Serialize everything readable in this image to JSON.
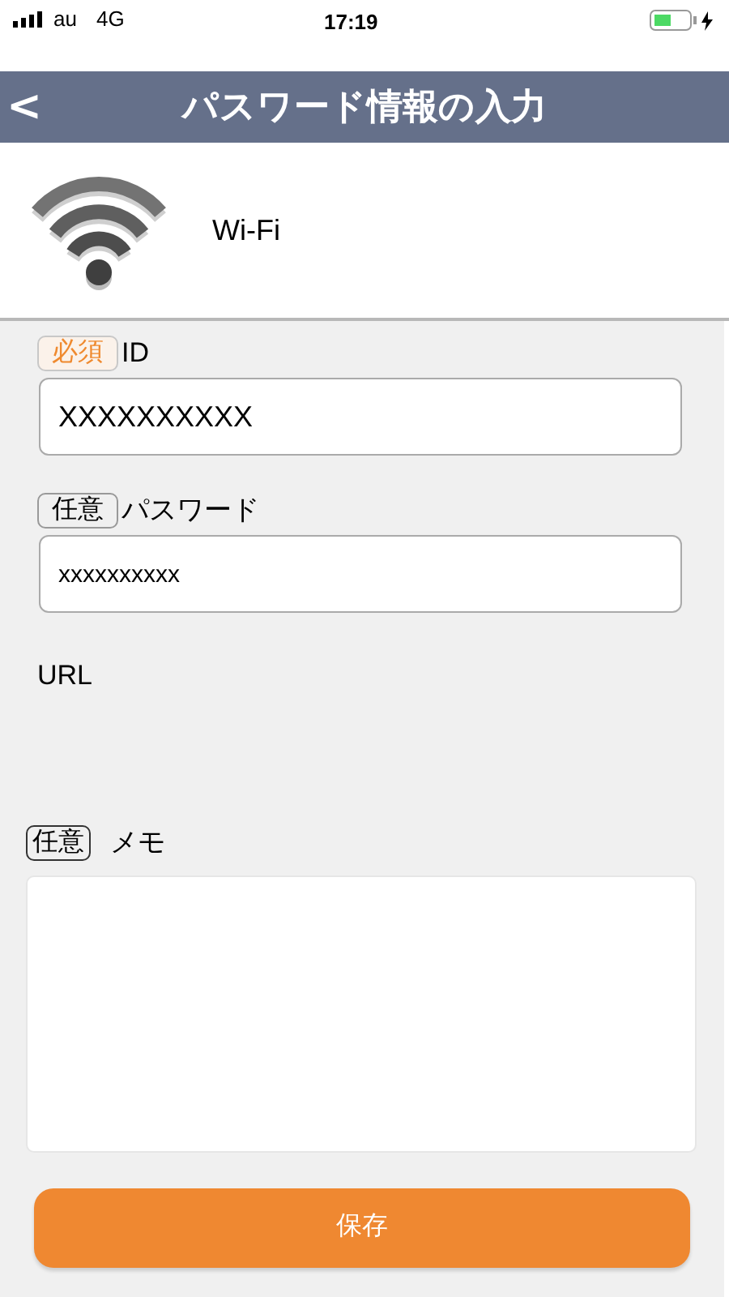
{
  "status_bar": {
    "carrier": "au",
    "network": "4G",
    "time": "17:19"
  },
  "header": {
    "back": "<",
    "title": "パスワード情報の入力"
  },
  "item": {
    "name": "Wi-Fi"
  },
  "fields": [
    {
      "badge": "必須",
      "required": true,
      "label": "ID",
      "value": "XXXXXXXXXX",
      "kind": "input"
    },
    {
      "badge": "任意",
      "required": false,
      "label": "パスワード",
      "value": "xxxxxxxxxx",
      "kind": "input"
    },
    {
      "label": "URL",
      "kind": "label"
    }
  ],
  "memo": {
    "badge": "任意",
    "required": false,
    "label": "メモ"
  },
  "save_button": "保存"
}
